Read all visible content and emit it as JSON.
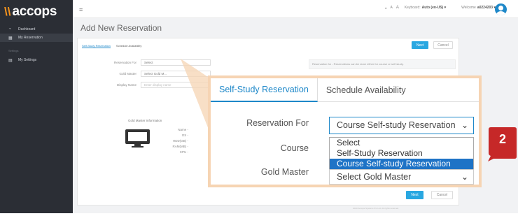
{
  "brand": {
    "name": "accops"
  },
  "sidebar": {
    "items": [
      {
        "label": "Dashboard",
        "icon": "dashboard-icon"
      },
      {
        "label": "My Reservation",
        "icon": "calendar-icon"
      },
      {
        "label": "My Settings",
        "icon": "settings-icon"
      }
    ],
    "section_label": "Settings"
  },
  "topbar": {
    "font_controls": [
      "A",
      "A",
      "A"
    ],
    "keyboard_prefix": "Keyboard:",
    "keyboard_value": "Auto (en-US) ▾",
    "welcome_prefix": "Welcome",
    "welcome_user": "a0224203 ▾"
  },
  "page": {
    "title": "Add New Reservation",
    "tabs": [
      "Self-Study Reservation",
      "Schedule Availability"
    ],
    "next_label": "Next",
    "cancel_label": "Cancel",
    "fields": [
      {
        "label": "Reservation For",
        "value": "Select"
      },
      {
        "label": "Gold Master",
        "value": "Select Gold M..."
      },
      {
        "label": "Display Name",
        "placeholder": "Enter display name"
      }
    ],
    "note": "Reservation for - Reservations can be done either for course or self study.",
    "gold_master_info": {
      "title": "Gold Master Information",
      "rows": [
        "Name -",
        "OS -",
        "HDD(GB) -",
        "RAM(MB) -",
        "CPU -"
      ]
    },
    "footer": "2020 Accops Systems Pvt Ltd. All rights reserved."
  },
  "zoom": {
    "tabs": [
      "Self-Study Reservation",
      "Schedule Availability"
    ],
    "reservation_for_label": "Reservation For",
    "reservation_for_value": "Course Self-study Reservation",
    "course_label": "Course",
    "options": [
      "Select",
      "Self-Study Reservation",
      "Course Self-study Reservation"
    ],
    "selected_option_index": 2,
    "gold_master_label": "Gold Master",
    "gold_master_value": "Select Gold Master"
  },
  "step_badge": "2",
  "colors": {
    "accent": "#1e88c9",
    "sidebar": "#2b2e35",
    "brand_mark": "#f7941d",
    "highlight": "#1e73c6",
    "badge": "#c62828",
    "callout": "#f6d4b3"
  }
}
